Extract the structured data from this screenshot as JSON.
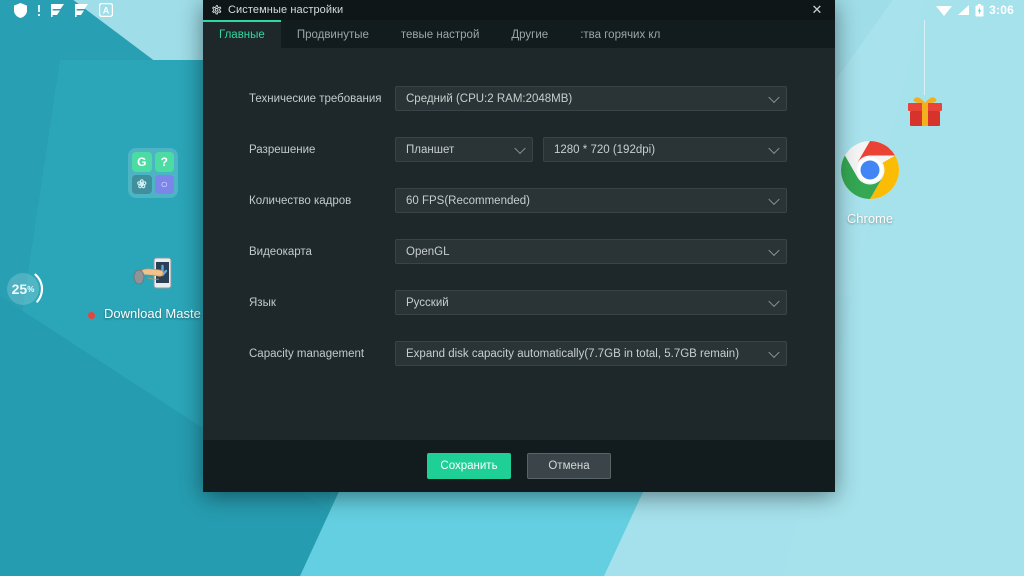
{
  "statusbar": {
    "left_icons": [
      "shield-icon",
      "dot-icon",
      "flag-play-icon",
      "flag-play-icon",
      "a-box-icon"
    ],
    "right_icons": [
      "wifi-icon",
      "signal-icon",
      "battery-icon"
    ],
    "clock": "3:06"
  },
  "desktop": {
    "folder": {
      "name": "app-folder",
      "apps": [
        {
          "name": "google-app-icon",
          "glyph": "G"
        },
        {
          "name": "help-app-icon",
          "glyph": "?"
        },
        {
          "name": "browser-app-icon",
          "glyph": "❀"
        },
        {
          "name": "camera-app-icon",
          "glyph": "○"
        }
      ]
    },
    "download_master": {
      "label": "Download Maste",
      "badge": true
    },
    "progress_badge": {
      "value": "25",
      "unit": "%",
      "percent": 25
    },
    "chrome": {
      "label": "Chrome"
    },
    "gift": {
      "name": "gift-box-icon"
    }
  },
  "dialog": {
    "title": "Системные настройки",
    "title_icon": "gear-icon",
    "close_label": "✕",
    "tabs": [
      {
        "label": "Главные",
        "active": true
      },
      {
        "label": "Продвинутые",
        "active": false
      },
      {
        "label": "тевые настрой",
        "active": false
      },
      {
        "label": "Другие",
        "active": false
      },
      {
        "label": ":тва горячих кл",
        "active": false
      }
    ],
    "rows": [
      {
        "label": "Технические требования",
        "fields": [
          {
            "value": "Средний (CPU:2 RAM:2048MB)",
            "width": "full"
          }
        ]
      },
      {
        "label": "Разрешение",
        "fields": [
          {
            "value": "Планшет",
            "width": "half"
          },
          {
            "value": "1280 * 720 (192dpi)",
            "width": "rest"
          }
        ]
      },
      {
        "label": "Количество кадров",
        "fields": [
          {
            "value": "60 FPS(Recommended)",
            "width": "full"
          }
        ]
      },
      {
        "label": "Видеокарта",
        "fields": [
          {
            "value": "OpenGL",
            "width": "full"
          }
        ]
      },
      {
        "label": "Язык",
        "fields": [
          {
            "value": "Русский",
            "width": "full"
          }
        ]
      },
      {
        "label": "Capacity management",
        "fields": [
          {
            "value": "Expand disk capacity automatically(7.7GB in total, 5.7GB remain)",
            "width": "full"
          }
        ]
      }
    ],
    "buttons": {
      "save": "Сохранить",
      "cancel": "Отмена"
    }
  },
  "colors": {
    "accent_green": "#1ecf96",
    "tab_active": "#2fd8a0",
    "dialog_bg": "#1e2729",
    "titlebar_bg": "#0e1618",
    "field_bg": "#2a3336",
    "wallpaper_teal": "#2ba6b8",
    "wallpaper_pale": "#a6e2ec"
  }
}
